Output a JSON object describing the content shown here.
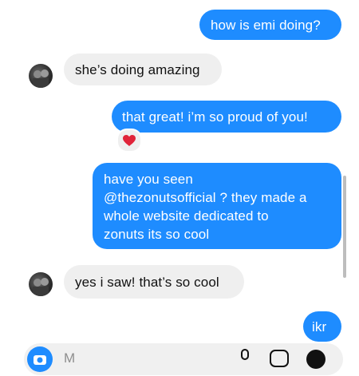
{
  "messages": [
    {
      "id": "m1",
      "direction": "outgoing",
      "text": "how is emi doing?"
    },
    {
      "id": "m2",
      "direction": "incoming",
      "text": "she’s doing amazing"
    },
    {
      "id": "m3",
      "direction": "outgoing",
      "text": "that great! i’m so proud of you!",
      "reaction": "heart-icon"
    },
    {
      "id": "m4",
      "direction": "outgoing",
      "lines": [
        "have you seen",
        "@thezonutsofficial ? they made a",
        "whole website dedicated to",
        "zonuts its so cool"
      ]
    },
    {
      "id": "m5",
      "direction": "incoming",
      "text": "yes i saw! that’s so cool"
    },
    {
      "id": "m6",
      "direction": "outgoing",
      "text": "ikr"
    }
  ],
  "composer": {
    "placeholder": "M"
  },
  "colors": {
    "outgoing": "#1e8cff",
    "incoming": "#efefef",
    "reaction_heart": "#e0243a"
  }
}
